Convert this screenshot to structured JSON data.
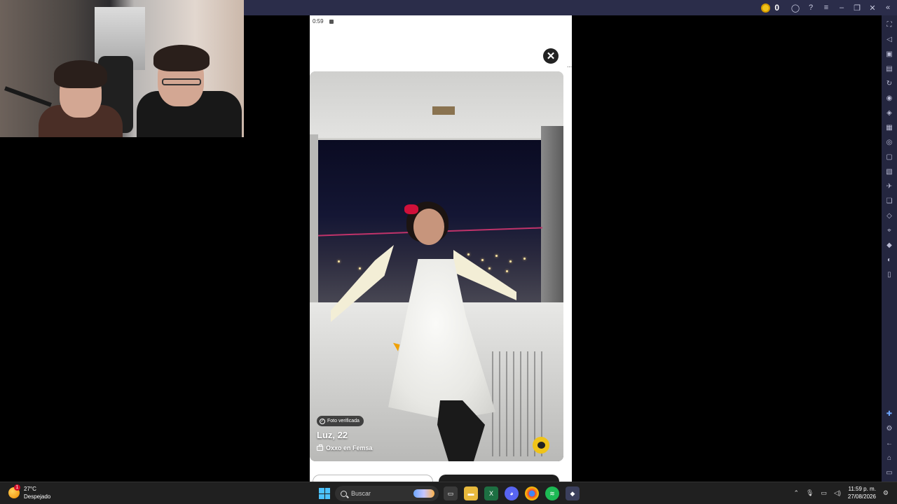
{
  "emulator": {
    "coin_count": "0",
    "titlebar_icons": [
      "account-icon",
      "help-icon",
      "menu-icon",
      "minimize-icon",
      "restore-icon",
      "close-icon",
      "collapse-sidebar-icon"
    ],
    "sidebar_icons": [
      "fullscreen-icon",
      "volume-icon",
      "apk-icon",
      "keyboard-icon",
      "sync-icon",
      "macro-icon",
      "gamepad-icon",
      "performance-icon",
      "screenshot-icon",
      "record-icon",
      "media-icon",
      "airplane-icon",
      "multi-instance-icon",
      "eraser-icon",
      "location-icon",
      "layers-icon",
      "eco-icon",
      "more-icon",
      "add-icon",
      "settings-icon",
      "back-icon",
      "home-icon",
      "recents-icon"
    ]
  },
  "phone": {
    "status_time": "0:59",
    "close_symbol": "✕",
    "profile": {
      "verified_label": "Foto verificada",
      "name_age": "Luz, 22",
      "job": "Oxxo en Femsa"
    }
  },
  "taskbar": {
    "weather": {
      "temperature": "27°C",
      "condition": "Despejado",
      "alert_count": "1"
    },
    "search_placeholder": "Buscar",
    "time": "11:59 p. m.",
    "date": "27/08/2026"
  }
}
